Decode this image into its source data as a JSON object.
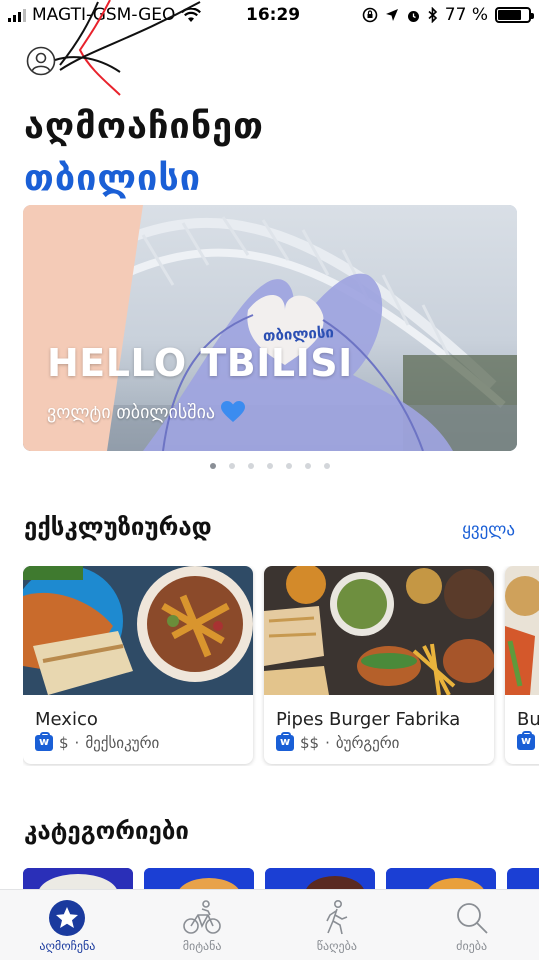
{
  "status_bar": {
    "carrier": "MAGTI-GSM-GEO",
    "time": "16:29",
    "battery": "77 %"
  },
  "header": {
    "title": "აღმოაჩინეთ",
    "city": "თბილისი"
  },
  "banner": {
    "headline": "HELLO TBILISI",
    "subline": "ვოლტი თბილისშია",
    "tag": "თბილისი",
    "page_count": 7,
    "active_page": 1
  },
  "exclusive": {
    "title": "ექსკლუზიურად",
    "see_all": "ყველა",
    "cards": [
      {
        "name": "Mexico",
        "price": "$",
        "cuisine": "მექსიკური"
      },
      {
        "name": "Pipes Burger Fabrika",
        "price": "$$",
        "cuisine": "ბურგერი"
      },
      {
        "name": "Bu"
      }
    ]
  },
  "categories": {
    "title": "კატეგორიები"
  },
  "tabbar": {
    "tabs": [
      {
        "label": "აღმოჩენა",
        "icon": "star-icon",
        "active": true
      },
      {
        "label": "მიტანა",
        "icon": "bike-icon",
        "active": false
      },
      {
        "label": "წაღება",
        "icon": "walking-icon",
        "active": false
      },
      {
        "label": "ძიება",
        "icon": "search-icon",
        "active": false
      }
    ]
  },
  "colors": {
    "accent": "#1a5fd6",
    "tab_active": "#1a3a9e",
    "category_tile": "#1b3fd4"
  }
}
